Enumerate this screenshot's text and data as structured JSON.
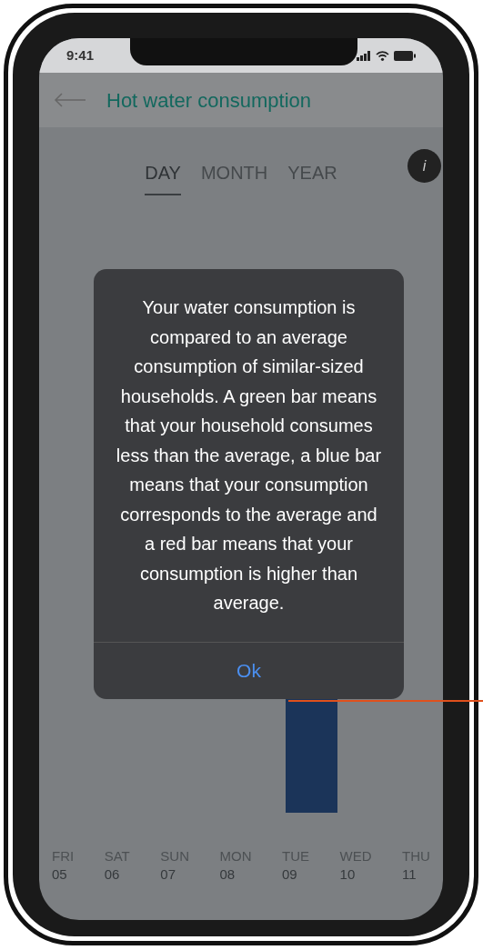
{
  "status_bar": {
    "time": "9:41"
  },
  "header": {
    "title": "Hot water consumption"
  },
  "tabs": [
    {
      "label": "DAY",
      "selected": true
    },
    {
      "label": "MONTH",
      "selected": false
    },
    {
      "label": "YEAR",
      "selected": false
    }
  ],
  "info_button": {
    "label": "i"
  },
  "days": [
    {
      "day": "FRI",
      "date": "05"
    },
    {
      "day": "SAT",
      "date": "06"
    },
    {
      "day": "SUN",
      "date": "07"
    },
    {
      "day": "MON",
      "date": "08"
    },
    {
      "day": "TUE",
      "date": "09"
    },
    {
      "day": "WED",
      "date": "10"
    },
    {
      "day": "THU",
      "date": "11"
    }
  ],
  "dialog": {
    "message": "Your water consumption is compared to an average consumption of similar-sized households. A green bar means that your household consumes less than the average, a blue bar means that your consumption corresponds to the average and a red bar means that your consumption is higher than average.",
    "button": "Ok"
  }
}
